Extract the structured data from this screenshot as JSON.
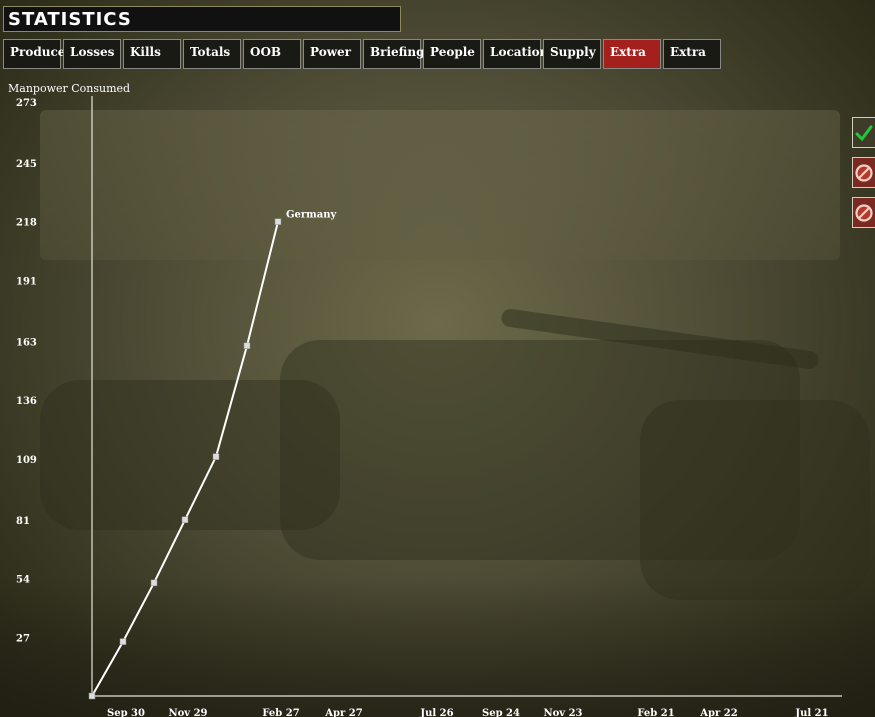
{
  "window": {
    "title": "STATISTICS"
  },
  "tabs": [
    {
      "label": "Produce",
      "active": false
    },
    {
      "label": "Losses",
      "active": false
    },
    {
      "label": "Kills",
      "active": false
    },
    {
      "label": "Totals",
      "active": false
    },
    {
      "label": "OOB",
      "active": false
    },
    {
      "label": "Power",
      "active": false
    },
    {
      "label": "Briefing",
      "active": false
    },
    {
      "label": "People",
      "active": false
    },
    {
      "label": "Location",
      "active": false
    },
    {
      "label": "Supply",
      "active": false
    },
    {
      "label": "Extra",
      "active": true
    },
    {
      "label": "Extra",
      "active": false
    }
  ],
  "side_buttons": [
    {
      "icon": "check-icon"
    },
    {
      "icon": "no-entry-icon"
    },
    {
      "icon": "no-entry-icon"
    }
  ],
  "colors": {
    "active_tab": "#a3201c",
    "line": "#ffffff",
    "axis": "#e6e6d8"
  },
  "chart_data": {
    "type": "line",
    "ylabel": "Manpower Consumed",
    "ylim": [
      0,
      273
    ],
    "y_ticks": [
      "27",
      "54",
      "81",
      "109",
      "136",
      "163",
      "191",
      "218",
      "245",
      "273"
    ],
    "x_ticks": [
      "Sep 30",
      "Nov 29",
      "Feb 27",
      "Apr 27",
      "Jul 26",
      "Sep 24",
      "Nov 23",
      "Feb 21",
      "Apr 22",
      "Jul 21"
    ],
    "series": [
      {
        "name": "Germany",
        "points": [
          {
            "x": 0,
            "y": 0
          },
          {
            "x": 1,
            "y": 25
          },
          {
            "x": 2,
            "y": 52
          },
          {
            "x": 3,
            "y": 81
          },
          {
            "x": 4,
            "y": 110
          },
          {
            "x": 5,
            "y": 161
          },
          {
            "x": 6,
            "y": 218
          }
        ]
      }
    ]
  }
}
